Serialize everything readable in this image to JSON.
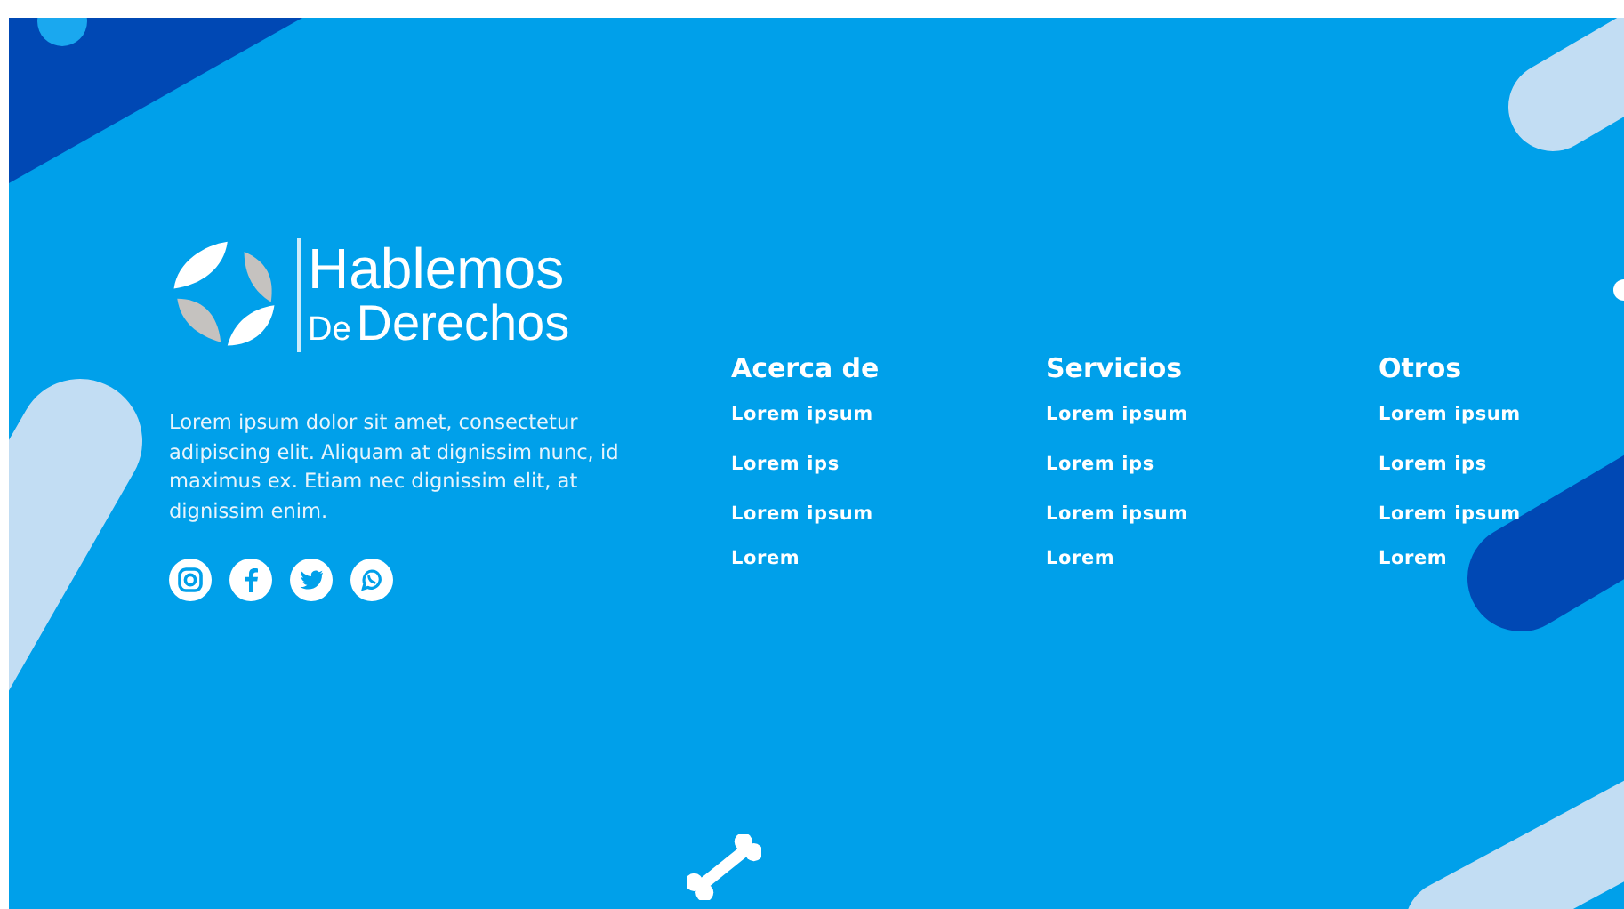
{
  "logo": {
    "line1": "Hablemos",
    "prefix": "De",
    "line2": "Derechos"
  },
  "description": "Lorem ipsum dolor sit amet, consectetur adipiscing elit. Aliquam at dignissim nunc, id maximus ex. Etiam nec dignissim elit, at dignissim enim.",
  "social": [
    {
      "kind": "instagram"
    },
    {
      "kind": "facebook"
    },
    {
      "kind": "twitter"
    },
    {
      "kind": "whatsapp"
    }
  ],
  "columns": [
    {
      "heading": "Acerca de",
      "links": [
        "Lorem ipsum",
        "Lorem ips",
        "Lorem ipsum",
        "Lorem"
      ]
    },
    {
      "heading": "Servicios",
      "links": [
        "Lorem ipsum",
        "Lorem ips",
        "Lorem ipsum",
        "Lorem"
      ]
    },
    {
      "heading": "Otros",
      "links": [
        "Lorem ipsum",
        "Lorem ips",
        "Lorem ipsum",
        "Lorem"
      ]
    }
  ]
}
